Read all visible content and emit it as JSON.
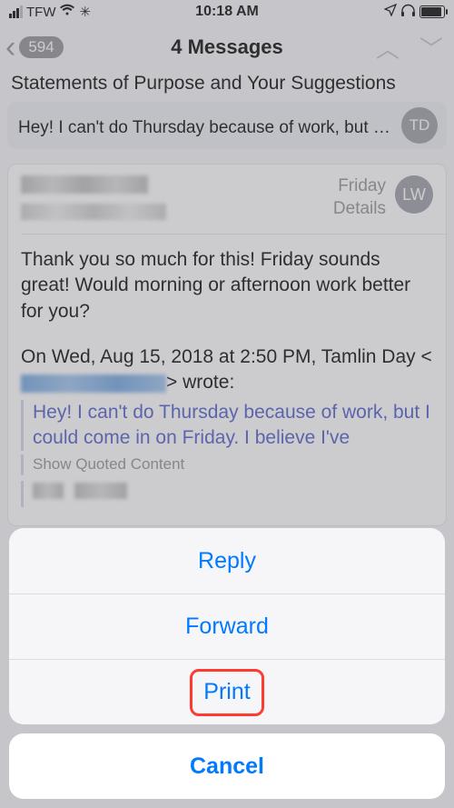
{
  "status": {
    "carrier": "TFW",
    "time": "10:18 AM"
  },
  "nav": {
    "back_count": "594",
    "title": "4 Messages",
    "subject": "Statements of Purpose and Your Suggestions"
  },
  "prev_message": {
    "avatar_initials": "TD",
    "preview": "Hey! I can't do Thursday because of work, but I co..."
  },
  "message": {
    "meta_day": "Friday",
    "meta_details": "Details",
    "avatar_initials": "LW",
    "body_p1": "Thank you so much for this! Friday sounds great! Would morning or afternoon work better for you?",
    "quoted_intro_pre": "On Wed, Aug 15, 2018 at 2:50 PM, Tamlin Day <",
    "quoted_intro_post": "> wrote:",
    "quote_text": "Hey! I can't do Thursday because of work, but I could come in on Friday. I believe I've",
    "show_quoted": "Show Quoted Content"
  },
  "sheet": {
    "reply": "Reply",
    "forward": "Forward",
    "print": "Print",
    "cancel": "Cancel"
  }
}
